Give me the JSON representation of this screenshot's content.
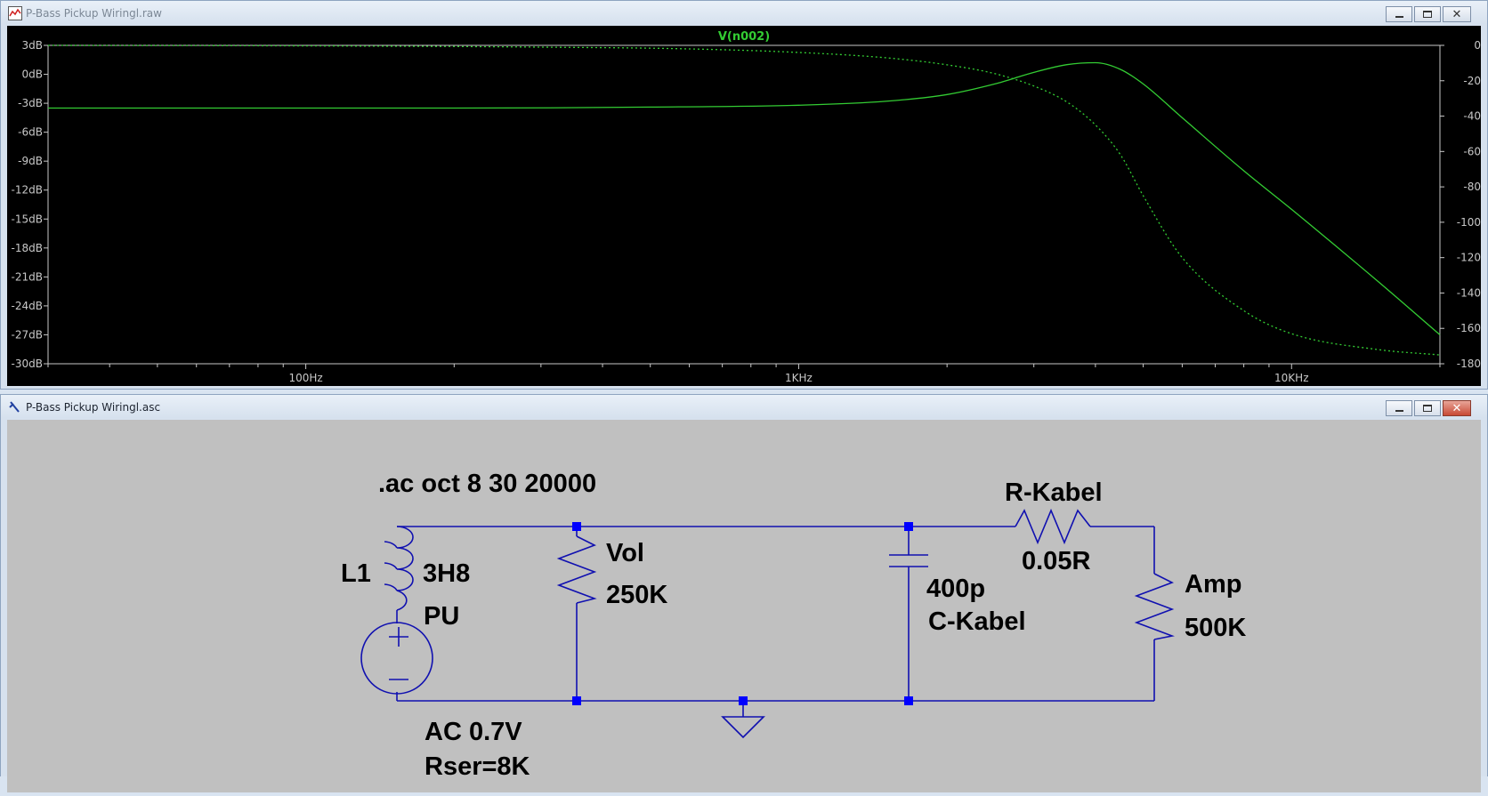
{
  "plot_window": {
    "title": "P-Bass Pickup Wiringl.raw",
    "icon": "waveform-icon",
    "trace_label": "V(n002)",
    "trace_color": "#33cc33",
    "y_left_ticks": [
      "3dB",
      "0dB",
      "-3dB",
      "-6dB",
      "-9dB",
      "-12dB",
      "-15dB",
      "-18dB",
      "-21dB",
      "-24dB",
      "-27dB",
      "-30dB"
    ],
    "y_right_ticks": [
      "0°",
      "-20°",
      "-40°",
      "-60°",
      "-80°",
      "-100°",
      "-120°",
      "-140°",
      "-160°",
      "-180°"
    ],
    "x_ticks": [
      "100Hz",
      "1KHz",
      "10KHz"
    ]
  },
  "schematic_window": {
    "title": "P-Bass Pickup Wiringl.asc",
    "icon": "schematic-icon",
    "directive": ".ac oct 8 30 20000",
    "labels": {
      "l1_name": "L1",
      "l1_value": "3H8",
      "source_name": "PU",
      "vol_name": "Vol",
      "vol_value": "250K",
      "cap_value": "400p",
      "cap_name": "C-Kabel",
      "r_kabel_name": "R-Kabel",
      "r_kabel_value": "0.05R",
      "amp_name": "Amp",
      "amp_value": "500K",
      "source_value": "AC 0.7V",
      "source_rser": "Rser=8K"
    },
    "wire_color": "#1010b0",
    "node_color": "#0000ff"
  },
  "chart_data": {
    "type": "line",
    "title": "V(n002)",
    "xscale": "log",
    "xlim": [
      30,
      20000
    ],
    "ylim_left": [
      -30,
      3
    ],
    "ylim_right": [
      -180,
      0
    ],
    "series": [
      {
        "name": "V(n002)",
        "style": "solid",
        "axis": "left",
        "x": [
          30,
          100,
          200,
          500,
          1000,
          1500,
          2000,
          2500,
          3000,
          3500,
          4000,
          4500,
          5000,
          6000,
          8000,
          10000,
          15000,
          20000
        ],
        "values": [
          -3.5,
          -3.5,
          -3.5,
          -3.4,
          -3.2,
          -2.8,
          -2.1,
          -1.0,
          0.2,
          1.0,
          1.2,
          0.5,
          -1.0,
          -4.5,
          -10.0,
          -14.0,
          -21.5,
          -27.0
        ]
      },
      {
        "name": "V(n002)",
        "style": "dashed",
        "axis": "right",
        "x": [
          30,
          100,
          300,
          600,
          1000,
          1500,
          2000,
          2500,
          3000,
          3500,
          4000,
          4500,
          5000,
          6000,
          8000,
          10000,
          15000,
          20000
        ],
        "values": [
          0,
          -0.3,
          -1,
          -2,
          -4,
          -7,
          -11,
          -16,
          -23,
          -32,
          -45,
          -62,
          -85,
          -120,
          -150,
          -163,
          -172,
          -175
        ]
      }
    ]
  }
}
